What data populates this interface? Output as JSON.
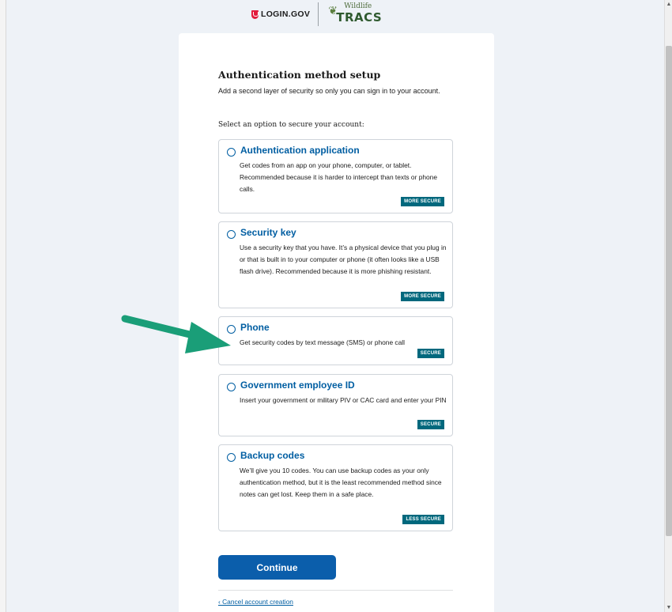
{
  "header": {
    "login_logo_text": "LOGIN.GOV",
    "partner_logo_top": "Wildlife",
    "partner_logo_main": "TRACS"
  },
  "page": {
    "title": "Authentication method setup",
    "intro": "Add a second layer of security so only you can sign in to your account.",
    "select_label": "Select an option to secure your account:"
  },
  "options": [
    {
      "title": "Authentication application",
      "description": "Get codes from an app on your phone, computer, or tablet. Recommended because it is harder to intercept than texts or phone calls.",
      "badge": "MORE SECURE"
    },
    {
      "title": "Security key",
      "description": "Use a security key that you have. It’s a physical device that you plug in or that is built in to your computer or phone (it often looks like a USB flash drive). Recommended because it is more phishing resistant.",
      "badge": "MORE SECURE"
    },
    {
      "title": "Phone",
      "description": "Get security codes by text message (SMS) or phone call",
      "badge": "SECURE"
    },
    {
      "title": "Government employee ID",
      "description": "Insert your government or military PIV or CAC card and enter your PIN",
      "badge": "SECURE"
    },
    {
      "title": "Backup codes",
      "description": "We’ll give you 10 codes. You can use backup codes as your only authentication method, but it is the least recommended method since notes can get lost. Keep them in a safe place.",
      "badge": "LESS SECURE"
    }
  ],
  "actions": {
    "continue_label": "Continue",
    "cancel_label": "‹ Cancel account creation"
  },
  "colors": {
    "brand_blue": "#005ea2",
    "badge_teal": "#00687d",
    "annotation_arrow": "#1a9e78"
  }
}
